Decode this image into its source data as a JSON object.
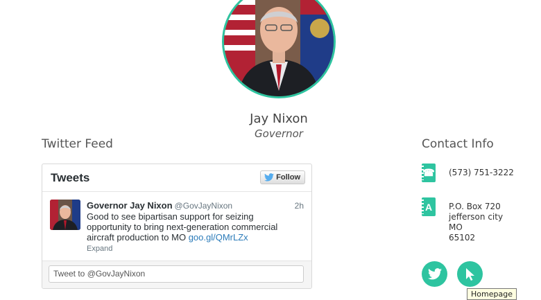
{
  "profile": {
    "name": "Jay Nixon",
    "role": "Governor"
  },
  "twitter": {
    "section_title": "Twitter Feed",
    "widget_title": "Tweets",
    "follow_label": "Follow",
    "tweet": {
      "author": "Governor Jay Nixon",
      "handle": "@GovJayNixon",
      "time": "2h",
      "text": "Good to see bipartisan support for seizing opportunity to bring next-generation commercial aircraft production to MO",
      "link": "goo.gl/QMrLZx",
      "expand_label": "Expand"
    },
    "input_placeholder": "Tweet to @GovJayNixon"
  },
  "contact": {
    "section_title": "Contact Info",
    "phone": "(573) 751-3222",
    "phone_icon_glyph": "☎",
    "address_icon_glyph": "A",
    "address": {
      "line1": "P.O. Box 720",
      "line2": "jefferson city",
      "line3": "MO",
      "line4": "65102"
    }
  },
  "buttons": {
    "twitter_icon": "twitter-bird-icon",
    "homepage_icon": "cursor-pointer-icon"
  },
  "tooltip": "Homepage",
  "colors": {
    "accent": "#2ec4a0",
    "twitter_blue": "#55acee",
    "link": "#2b7bb9"
  }
}
